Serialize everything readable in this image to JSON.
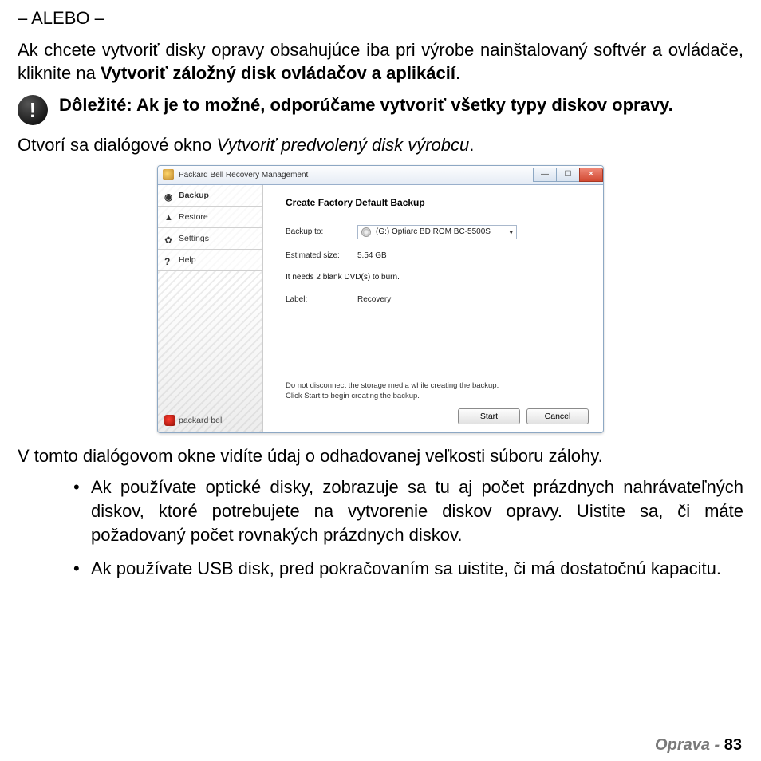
{
  "doc": {
    "alebo": "– ALEBO –",
    "para1_a": "Ak chcete vytvoriť disky opravy obsahujúce iba pri výrobe nainštalovaný softvér a ovládače, kliknite na ",
    "para1_b_bold": "Vytvoriť záložný disk ovládačov a aplikácií",
    "para1_c": ".",
    "important": "Dôležité: Ak je to možné, odporúčame vytvoriť všetky typy diskov opravy.",
    "para2_a": "Otvorí sa dialógové okno ",
    "para2_b_italic": "Vytvoriť predvolený disk výrobcu",
    "para2_c": ".",
    "para3": "V tomto dialógovom okne vidíte údaj o odhadovanej veľkosti súboru zálohy.",
    "bullet1": "Ak používate optické disky, zobrazuje sa tu aj počet prázdnych nahrávateľných diskov, ktoré potrebujete na vytvorenie diskov opravy. Uistite sa, či máte požadovaný počet rovnakých prázdnych diskov.",
    "bullet2": "Ak používate USB disk, pred pokračovaním sa uistite, či má dostatočnú kapacitu."
  },
  "footer": {
    "section": "Oprava - ",
    "page": "83"
  },
  "win": {
    "title": "Packard Bell Recovery Management",
    "nav": {
      "backup": "Backup",
      "restore": "Restore",
      "settings": "Settings",
      "help": "Help"
    },
    "brand": "packard bell",
    "heading": "Create Factory Default Backup",
    "labels": {
      "backup_to": "Backup to:",
      "est": "Estimated size:",
      "label": "Label:"
    },
    "values": {
      "drive": "(G:) Optiarc  BD ROM BC-5500S",
      "est": "5.54 GB",
      "label": "Recovery"
    },
    "dvd_note": "It needs 2 blank DVD(s) to burn.",
    "info1": "Do not disconnect the storage media while creating the backup.",
    "info2": "Click Start to begin creating the backup.",
    "buttons": {
      "start": "Start",
      "cancel": "Cancel"
    }
  }
}
